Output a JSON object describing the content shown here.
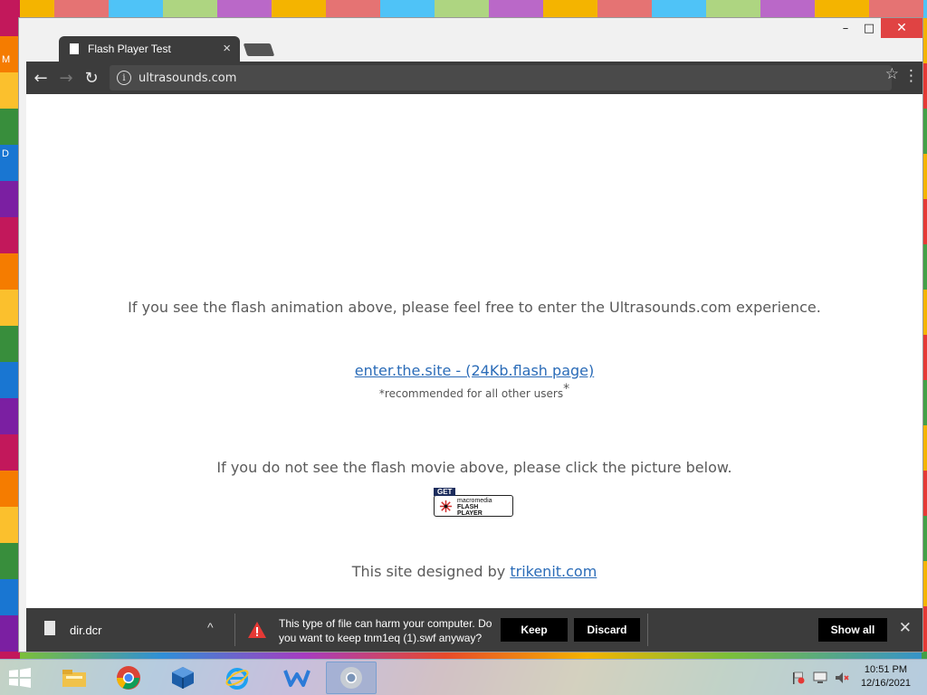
{
  "desktop": {
    "left_glyphs": [
      "M",
      "D"
    ]
  },
  "window": {
    "tab_title": "Flash Player Test",
    "tab_close": "×",
    "controls": {
      "minimize": "–",
      "maximize": "□",
      "close": "✕"
    }
  },
  "toolbar": {
    "back": "←",
    "forward": "→",
    "reload": "↻",
    "url": "ultrasounds.com",
    "info_glyph": "i",
    "star": "☆",
    "menu": "⋮"
  },
  "page": {
    "line1": "If you see the flash animation above, please feel free to enter the Ultrasounds.com experience.",
    "enter_link": "enter.the.site - (24Kb.flash page)",
    "recommended": "*recommended for all other users",
    "recommended_star": "*",
    "line2": "If you do not see the flash movie above, please click the picture below.",
    "badge": {
      "get": "GET",
      "macromedia": "macromedia",
      "flash": "FLASH",
      "player": "PLAYER"
    },
    "footer_prefix": "This site designed by ",
    "footer_link": "trikenit.com"
  },
  "download_bar": {
    "file_name": "dir.dcr",
    "chevron": "^",
    "warning_text": "This type of file can harm your computer. Do you want to keep tnm1eq (1).swf anyway?",
    "keep": "Keep",
    "discard": "Discard",
    "show_all": "Show all",
    "close": "✕"
  },
  "taskbar": {
    "time": "10:51 PM",
    "date": "12/16/2021",
    "apps": [
      "file-explorer",
      "chrome",
      "virtualbox",
      "internet-explorer",
      "wps",
      "chrome-active"
    ]
  }
}
